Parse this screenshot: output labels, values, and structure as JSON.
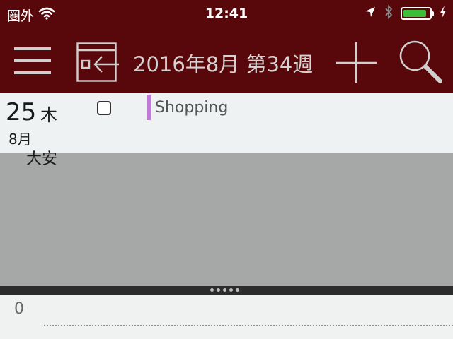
{
  "status_bar": {
    "carrier": "圏外",
    "time": "12:41",
    "battery_level": 0.9,
    "battery_color": "#3bbf3b"
  },
  "toolbar": {
    "title": "2016年8月 第34週",
    "background_color": "#58080b"
  },
  "event_day": {
    "day_number": "25",
    "weekday": "木",
    "month": "8月",
    "rokuyo": "大安"
  },
  "events": [
    {
      "title": "Shopping",
      "color": "#c27ad8",
      "completed": false
    }
  ],
  "timeline": {
    "hour_label": "0"
  }
}
